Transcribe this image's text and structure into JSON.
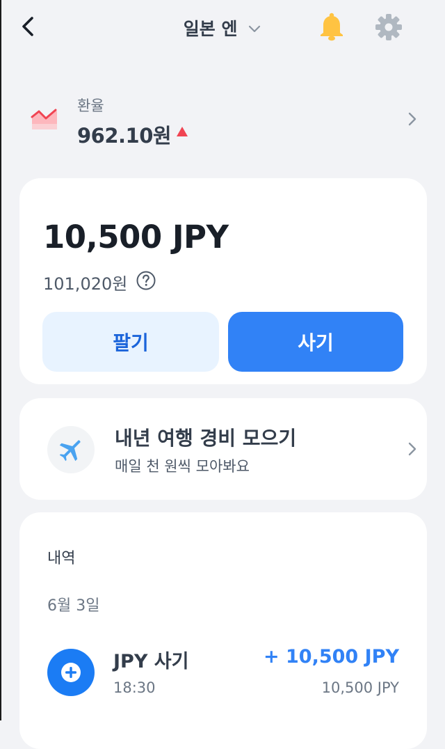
{
  "header": {
    "title": "일본 엔",
    "back_icon": "chevron-left-icon",
    "dropdown_icon": "chevron-down-icon",
    "notification_icon": "bell-icon",
    "settings_icon": "gear-icon"
  },
  "rate": {
    "label": "환율",
    "value": "962.10원",
    "trend": "up",
    "icon": "chart-icon"
  },
  "balance": {
    "amount": "10,500 JPY",
    "krw": "101,020원",
    "help_icon": "question-circle-icon",
    "sell_label": "팔기",
    "buy_label": "사기"
  },
  "savings": {
    "title": "내년 여행 경비 모으기",
    "subtitle": "매일 천 원씩 모아봐요",
    "icon": "airplane-icon"
  },
  "history": {
    "title": "내역",
    "groups": [
      {
        "date": "6월 3일",
        "items": [
          {
            "name": "JPY 사기",
            "time": "18:30",
            "amount": "+ 10,500 JPY",
            "balance": "10,500 JPY",
            "icon": "plus-circle-icon"
          }
        ]
      }
    ]
  },
  "colors": {
    "primary": "#3182f6",
    "primary_light": "#e8f3ff",
    "up_red": "#f04452",
    "bell_yellow": "#ffc342",
    "background": "#f2f3f6"
  }
}
